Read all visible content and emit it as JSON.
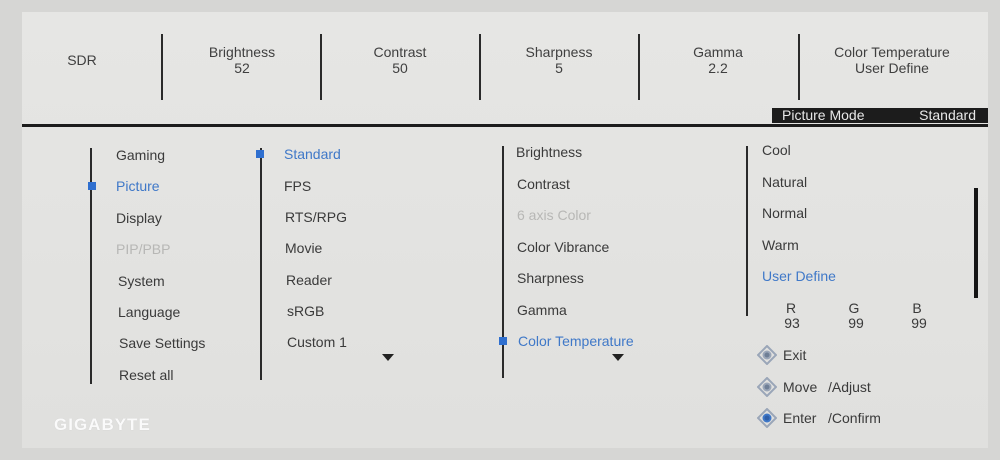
{
  "status_bar": {
    "mode": "SDR",
    "cells": [
      {
        "label": "Brightness",
        "value": "52"
      },
      {
        "label": "Contrast",
        "value": "50"
      },
      {
        "label": "Sharpness",
        "value": "5"
      },
      {
        "label": "Gamma",
        "value": "2.2"
      },
      {
        "label": "Color Temperature",
        "value": "User Define"
      }
    ]
  },
  "banner": {
    "label": "Picture Mode",
    "value": "Standard"
  },
  "menu_main": [
    "Gaming",
    "Picture",
    "Display",
    "PIP/PBP",
    "System",
    "Language",
    "Save Settings",
    "Reset all"
  ],
  "picture_modes": [
    "Standard",
    "FPS",
    "RTS/RPG",
    "Movie",
    "Reader",
    "sRGB",
    "Custom 1"
  ],
  "picture_settings": [
    "Brightness",
    "Contrast",
    "6 axis Color",
    "Color Vibrance",
    "Sharpness",
    "Gamma",
    "Color Temperature"
  ],
  "color_temps": [
    "Cool",
    "Natural",
    "Normal",
    "Warm",
    "User Define"
  ],
  "rgb": {
    "r_label": "R",
    "g_label": "G",
    "b_label": "B",
    "r": "93",
    "g": "99",
    "b": "99"
  },
  "hints": {
    "exit": "Exit",
    "move": "Move",
    "adjust": "/Adjust",
    "enter": "Enter",
    "confirm": "/Confirm"
  },
  "brand": "GIGABYTE",
  "colors": {
    "accent": "#3f78c8",
    "bullet": "#2f6fcf",
    "disabled": "#b7b7b5",
    "banner": "#1c1c1c"
  },
  "icons": {
    "hint": "joystick-icon",
    "more": "chevron-down-icon"
  }
}
